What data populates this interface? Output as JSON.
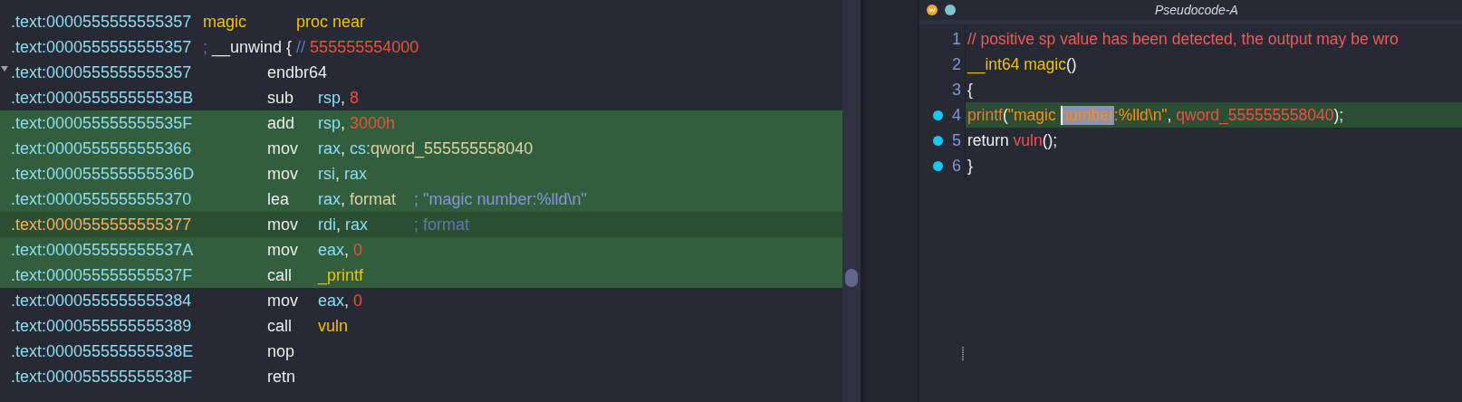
{
  "listing": {
    "rows": [
      {
        "address": ".text:0000555555555357",
        "kind": "proc",
        "selected": false,
        "current": false,
        "collapse": false,
        "label": "magic",
        "directive": "proc near"
      },
      {
        "address": ".text:0000555555555357",
        "kind": "note",
        "selected": false,
        "current": false,
        "collapse": false,
        "tokens": [
          {
            "text": "; ",
            "kind": "comment"
          },
          {
            "text": "__unwind { ",
            "kind": "plain"
          },
          {
            "text": "// ",
            "kind": "comment"
          },
          {
            "text": "555555554000",
            "kind": "num"
          }
        ]
      },
      {
        "address": ".text:0000555555555357",
        "kind": "insn",
        "selected": false,
        "current": false,
        "collapse": true,
        "mnemonic": "endbr64",
        "operands": []
      },
      {
        "address": ".text:000055555555535B",
        "kind": "insn",
        "selected": false,
        "current": false,
        "collapse": false,
        "mnemonic": "sub",
        "operands": [
          {
            "text": "rsp",
            "kind": "reg"
          },
          {
            "text": ", ",
            "kind": "plain"
          },
          {
            "text": "8",
            "kind": "num"
          }
        ]
      },
      {
        "address": ".text:000055555555535F",
        "kind": "insn",
        "selected": true,
        "current": false,
        "collapse": false,
        "mnemonic": "add",
        "operands": [
          {
            "text": "rsp",
            "kind": "reg"
          },
          {
            "text": ", ",
            "kind": "plain"
          },
          {
            "text": "3000h",
            "kind": "num"
          }
        ]
      },
      {
        "address": ".text:0000555555555366",
        "kind": "insn",
        "selected": true,
        "current": false,
        "collapse": false,
        "mnemonic": "mov",
        "operands": [
          {
            "text": "rax",
            "kind": "reg"
          },
          {
            "text": ", ",
            "kind": "plain"
          },
          {
            "text": "cs:",
            "kind": "reg"
          },
          {
            "text": "qword_555555558040",
            "kind": "data"
          }
        ]
      },
      {
        "address": ".text:000055555555536D",
        "kind": "insn",
        "selected": true,
        "current": false,
        "collapse": false,
        "mnemonic": "mov",
        "operands": [
          {
            "text": "rsi",
            "kind": "reg"
          },
          {
            "text": ", ",
            "kind": "plain"
          },
          {
            "text": "rax",
            "kind": "reg"
          }
        ]
      },
      {
        "address": ".text:0000555555555370",
        "kind": "insn",
        "selected": true,
        "current": false,
        "collapse": false,
        "mnemonic": "lea",
        "operands": [
          {
            "text": "rax",
            "kind": "reg"
          },
          {
            "text": ", ",
            "kind": "plain"
          },
          {
            "text": "format",
            "kind": "data"
          }
        ],
        "comment": {
          "text": "; \"magic number:%lld\\n\"",
          "kind": "string"
        }
      },
      {
        "address": ".text:0000555555555377",
        "kind": "insn",
        "selected": true,
        "current": true,
        "collapse": false,
        "mnemonic": "mov",
        "operands": [
          {
            "text": "rdi",
            "kind": "reg"
          },
          {
            "text": ", ",
            "kind": "plain"
          },
          {
            "text": "rax",
            "kind": "reg"
          }
        ],
        "comment": {
          "text": "; format",
          "kind": "auto"
        }
      },
      {
        "address": ".text:000055555555537A",
        "kind": "insn",
        "selected": true,
        "current": false,
        "collapse": false,
        "mnemonic": "mov",
        "operands": [
          {
            "text": "eax",
            "kind": "reg"
          },
          {
            "text": ", ",
            "kind": "plain"
          },
          {
            "text": "0",
            "kind": "num"
          }
        ]
      },
      {
        "address": ".text:000055555555537F",
        "kind": "insn",
        "selected": true,
        "current": false,
        "collapse": false,
        "mnemonic": "call",
        "operands": [
          {
            "text": "_printf",
            "kind": "func"
          }
        ]
      },
      {
        "address": ".text:0000555555555384",
        "kind": "insn",
        "selected": false,
        "current": false,
        "collapse": false,
        "mnemonic": "mov",
        "operands": [
          {
            "text": "eax",
            "kind": "reg"
          },
          {
            "text": ", ",
            "kind": "plain"
          },
          {
            "text": "0",
            "kind": "num"
          }
        ]
      },
      {
        "address": ".text:0000555555555389",
        "kind": "insn",
        "selected": false,
        "current": false,
        "collapse": false,
        "mnemonic": "call",
        "operands": [
          {
            "text": "vuln",
            "kind": "func"
          }
        ]
      },
      {
        "address": ".text:000055555555538E",
        "kind": "insn",
        "selected": false,
        "current": false,
        "collapse": false,
        "mnemonic": "nop",
        "operands": []
      },
      {
        "address": ".text:000055555555538F",
        "kind": "insn",
        "selected": false,
        "current": false,
        "collapse": false,
        "mnemonic": "retn",
        "operands": []
      }
    ]
  },
  "pseudocode": {
    "title": "Pseudocode-A",
    "lines": [
      {
        "number": "1",
        "breakpoint": false,
        "highlighted": false,
        "tokens": [
          {
            "text": "// positive sp value has been detected, the output may be wro",
            "kind": "comment"
          }
        ]
      },
      {
        "number": "2",
        "breakpoint": false,
        "highlighted": false,
        "tokens": [
          {
            "text": "__int64 magic",
            "kind": "decl"
          },
          {
            "text": "()",
            "kind": "plain"
          }
        ]
      },
      {
        "number": "3",
        "breakpoint": false,
        "highlighted": false,
        "tokens": [
          {
            "text": "{",
            "kind": "plain"
          }
        ]
      },
      {
        "number": "4",
        "breakpoint": true,
        "highlighted": true,
        "tokens": [
          {
            "text": "printf",
            "kind": "call"
          },
          {
            "text": "(",
            "kind": "plain"
          },
          {
            "text": "\"magic ",
            "kind": "string"
          },
          {
            "text": "number",
            "kind": "string",
            "selected": true
          },
          {
            "text": ":%lld\\n\"",
            "kind": "string"
          },
          {
            "text": ", ",
            "kind": "plain"
          },
          {
            "text": "qword_555555558040",
            "kind": "global"
          },
          {
            "text": ");",
            "kind": "plain"
          }
        ]
      },
      {
        "number": "5",
        "breakpoint": true,
        "highlighted": false,
        "tokens": [
          {
            "text": "return ",
            "kind": "plain"
          },
          {
            "text": "vuln",
            "kind": "global"
          },
          {
            "text": "();",
            "kind": "plain"
          }
        ]
      },
      {
        "number": "6",
        "breakpoint": true,
        "highlighted": false,
        "tokens": [
          {
            "text": "}",
            "kind": "plain"
          }
        ]
      }
    ]
  }
}
